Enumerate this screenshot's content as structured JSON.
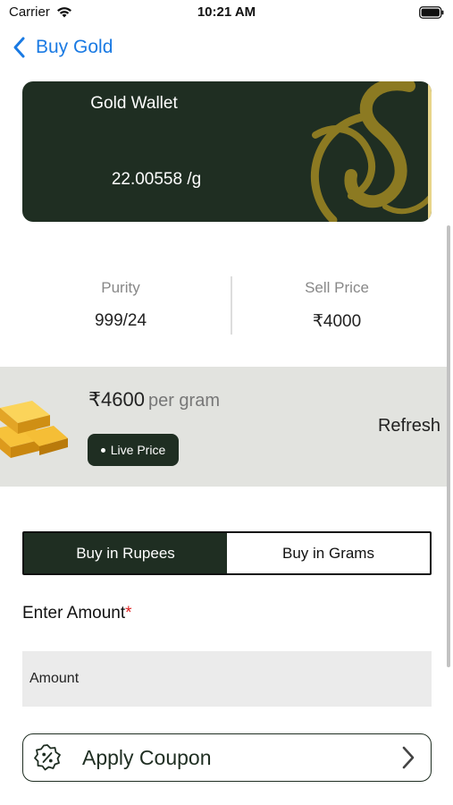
{
  "status_bar": {
    "carrier": "Carrier",
    "time": "10:21 AM"
  },
  "nav": {
    "back_title": "Buy Gold",
    "accent_color": "#1a7ae3"
  },
  "wallet": {
    "title": "Gold Wallet",
    "balance": "22.00558 /g",
    "card_color": "#1f2e22"
  },
  "stats": {
    "purity_label": "Purity",
    "purity_value": "999/24",
    "sell_price_label": "Sell Price",
    "sell_price_value": "₹4000"
  },
  "price": {
    "amount": "₹4600",
    "unit": "per gram",
    "live_badge": "Live Price",
    "refresh_label": "Refresh"
  },
  "segment": {
    "options": [
      "Buy in Rupees",
      "Buy in Grams"
    ],
    "selected": "Buy in Rupees"
  },
  "amount": {
    "label": "Enter Amount",
    "required_mark": "*",
    "placeholder": "Amount"
  },
  "coupon": {
    "label": "Apply Coupon",
    "icon": "percent-badge-icon"
  }
}
